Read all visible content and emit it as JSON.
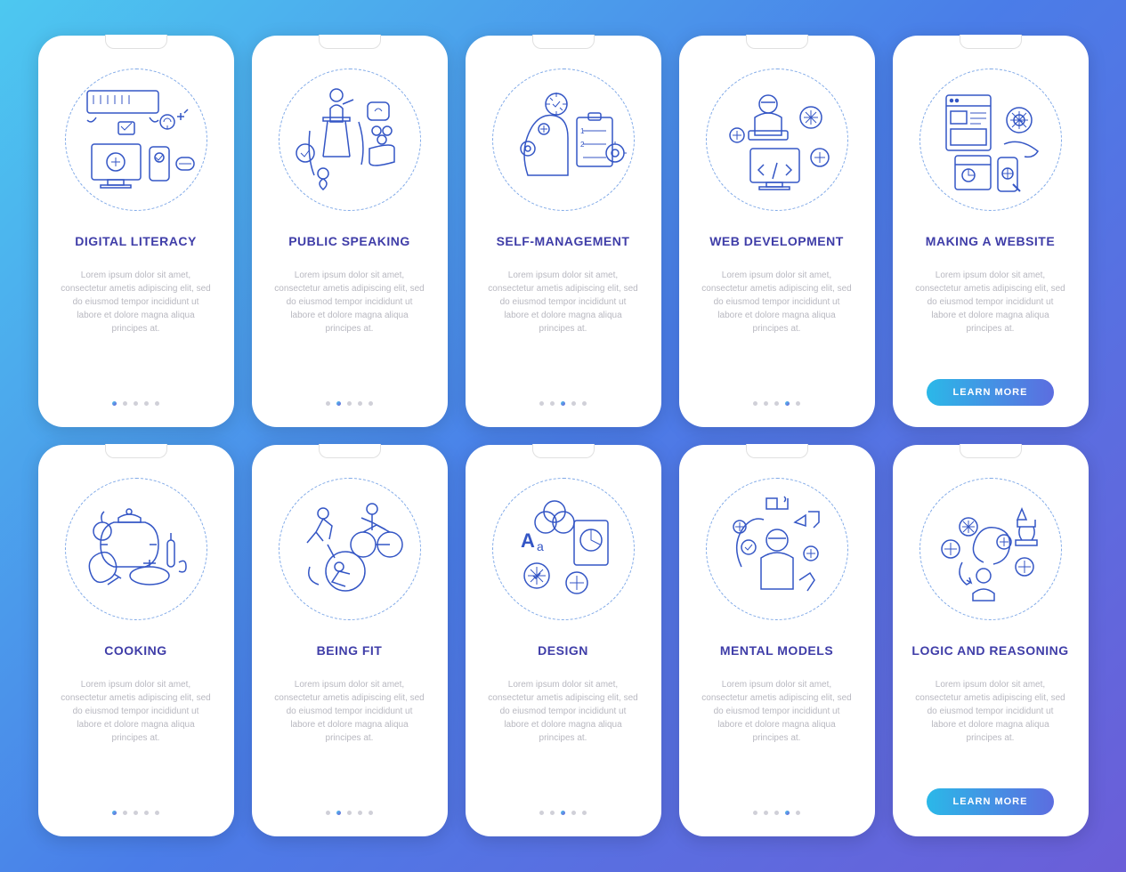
{
  "cards": [
    {
      "title": "DIGITAL LITERACY",
      "desc": "Lorem ipsum dolor sit amet, consectetur ametis adipiscing elit, sed do eiusmod tempor incididunt ut labore et dolore magna aliqua principes at.",
      "active_dot": 0,
      "has_button": false,
      "icon": "digital-literacy"
    },
    {
      "title": "PUBLIC SPEAKING",
      "desc": "Lorem ipsum dolor sit amet, consectetur ametis adipiscing elit, sed do eiusmod tempor incididunt ut labore et dolore magna aliqua principes at.",
      "active_dot": 1,
      "has_button": false,
      "icon": "public-speaking"
    },
    {
      "title": "SELF-MANAGEMENT",
      "desc": "Lorem ipsum dolor sit amet, consectetur ametis adipiscing elit, sed do eiusmod tempor incididunt ut labore et dolore magna aliqua principes at.",
      "active_dot": 2,
      "has_button": false,
      "icon": "self-management"
    },
    {
      "title": "WEB DEVELOPMENT",
      "desc": "Lorem ipsum dolor sit amet, consectetur ametis adipiscing elit, sed do eiusmod tempor incididunt ut labore et dolore magna aliqua principes at.",
      "active_dot": 3,
      "has_button": false,
      "icon": "web-development"
    },
    {
      "title": "MAKING A WEBSITE",
      "desc": "Lorem ipsum dolor sit amet, consectetur ametis adipiscing elit, sed do eiusmod tempor incididunt ut labore et dolore magna aliqua principes at.",
      "active_dot": -1,
      "has_button": true,
      "icon": "making-website"
    },
    {
      "title": "COOKING",
      "desc": "Lorem ipsum dolor sit amet, consectetur ametis adipiscing elit, sed do eiusmod tempor incididunt ut labore et dolore magna aliqua principes at.",
      "active_dot": 0,
      "has_button": false,
      "icon": "cooking"
    },
    {
      "title": "BEING FIT",
      "desc": "Lorem ipsum dolor sit amet, consectetur ametis adipiscing elit, sed do eiusmod tempor incididunt ut labore et dolore magna aliqua principes at.",
      "active_dot": 1,
      "has_button": false,
      "icon": "being-fit"
    },
    {
      "title": "DESIGN",
      "desc": "Lorem ipsum dolor sit amet, consectetur ametis adipiscing elit, sed do eiusmod tempor incididunt ut labore et dolore magna aliqua principes at.",
      "active_dot": 2,
      "has_button": false,
      "icon": "design"
    },
    {
      "title": "MENTAL MODELS",
      "desc": "Lorem ipsum dolor sit amet, consectetur ametis adipiscing elit, sed do eiusmod tempor incididunt ut labore et dolore magna aliqua principes at.",
      "active_dot": 3,
      "has_button": false,
      "icon": "mental-models"
    },
    {
      "title": "LOGIC AND REASONING",
      "desc": "Lorem ipsum dolor sit amet, consectetur ametis adipiscing elit, sed do eiusmod tempor incididunt ut labore et dolore magna aliqua principes at.",
      "active_dot": -1,
      "has_button": true,
      "icon": "logic-reasoning"
    }
  ],
  "button_label": "LEARN MORE",
  "dot_count": 5,
  "colors": {
    "stroke": "#3456c5",
    "title": "#3f3da8",
    "desc": "#b8b8c0"
  }
}
